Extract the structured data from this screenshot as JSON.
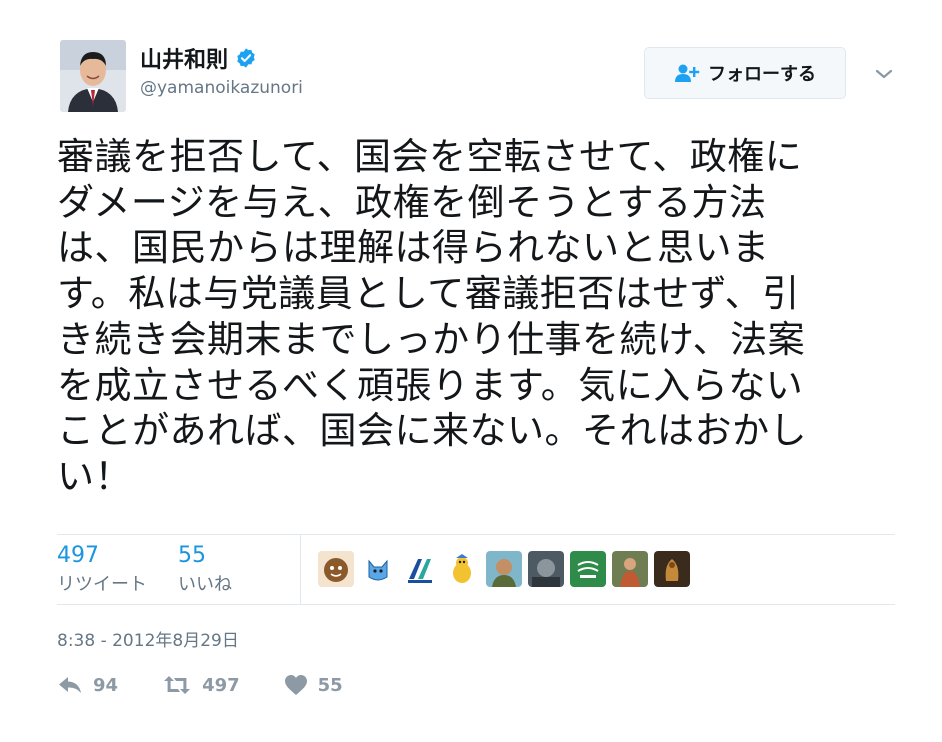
{
  "user": {
    "display_name": "山井和則",
    "handle": "@yamanoikazunori",
    "verified": true,
    "avatar_icon": "profile-photo"
  },
  "follow_button": {
    "label": "フォローする",
    "icon": "add-user-icon"
  },
  "menu_icon": "chevron-down-icon",
  "tweet": {
    "text": "審議を拒否して、国会を空転させて、政権に\nダメージを与え、政権を倒そうとする方法\nは、国民からは理解は得られないと思いま\nす。私は与党議員として審議拒否はせず、引\nき続き会期末までしっかり仕事を続け、法案\nを成立させるべく頑張ります。気に入らない\nことがあれば、国会に来ない。それはおかし\nい！"
  },
  "stats": {
    "retweets": {
      "value": "497",
      "label": "リツイート"
    },
    "likes": {
      "value": "55",
      "label": "いいね"
    }
  },
  "likers": [
    "liker-avatar-1",
    "liker-avatar-2",
    "liker-avatar-3",
    "liker-avatar-4",
    "liker-avatar-5",
    "liker-avatar-6",
    "liker-avatar-7",
    "liker-avatar-8",
    "liker-avatar-9"
  ],
  "timestamp": "8:38 - 2012年8月29日",
  "actions": {
    "reply_count": "94",
    "retweet_count": "497",
    "like_count": "55"
  },
  "colors": {
    "text": "#14171a",
    "secondary": "#657786",
    "link": "#1b95e0",
    "verified": "#1da1f2",
    "border": "#e1e8ed"
  }
}
